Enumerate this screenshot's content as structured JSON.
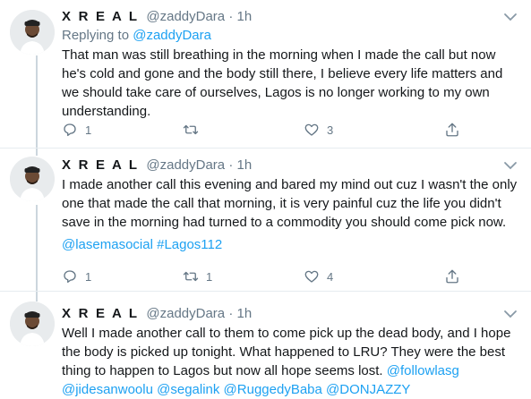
{
  "tweets": [
    {
      "name": "X R E A L",
      "handle": "@zaddyDara",
      "separator": "·",
      "time": "1h",
      "replying_label": "Replying to",
      "replying_to": "@zaddyDara",
      "text": "That man was still breathing in the morning when I made the call but now he's cold and gone and the body still there, I believe every life matters and we should take care of ourselves, Lagos is no longer working to my own understanding.",
      "replies": "1",
      "retweets": "",
      "likes": "3"
    },
    {
      "name": "X R E A L",
      "handle": "@zaddyDara",
      "separator": "·",
      "time": "1h",
      "text": "I made another call this evening and bared my mind out cuz I wasn't the only one that made the call that morning, it is very painful cuz the life you didn't save in the morning had turned to a commodity you should come pick now.",
      "tags": "@lasemasocial #Lagos112",
      "replies": "1",
      "retweets": "1",
      "likes": "4"
    },
    {
      "name": "X R E A L",
      "handle": "@zaddyDara",
      "separator": "·",
      "time": "1h",
      "text": "Well I made another call to them to come pick up the dead body, and I hope the body is picked up tonight. What happened to LRU? They were the best thing to happen to Lagos but now all hope seems lost.",
      "mentions_inline": "@followlasg",
      "mentions_line": "@jidesanwoolu @segalink @RuggedyBaba @DONJAZZY"
    }
  ],
  "icons": {
    "reply": "reply-icon",
    "retweet": "retweet-icon",
    "like": "heart-icon",
    "share": "share-icon",
    "more": "chevron-down-icon"
  },
  "colors": {
    "link": "#1da1f2",
    "secondary": "#657786",
    "divider": "#e6ecf0",
    "thread": "#ccd6dd"
  }
}
